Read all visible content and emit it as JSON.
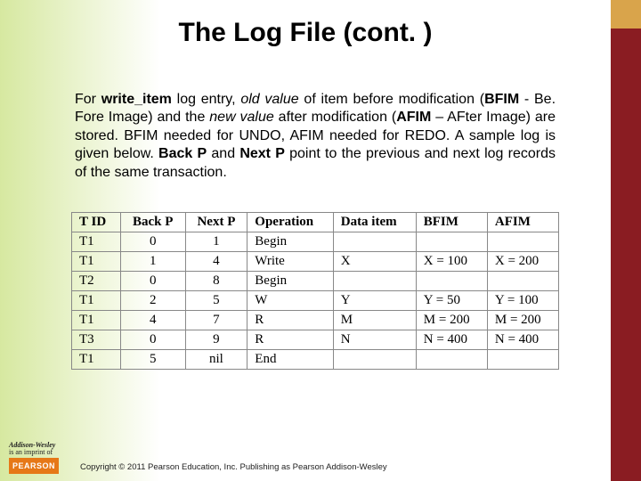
{
  "title": "The Log File (cont. )",
  "paragraph": {
    "p1": "For ",
    "write_item": "write_item",
    "p2": " log entry, ",
    "old_value": "old value",
    "p3": " of item before modification (",
    "bfim_bold": "BFIM",
    "p4": " - Be. Fore Image) and the ",
    "new_value": "new value",
    "p5": " after modification (",
    "afim_bold": "AFIM",
    "p6": " – AFter Image) are stored. BFIM needed for UNDO, AFIM needed for REDO.  A sample log is given below.  ",
    "backp": "Back P",
    "p7": " and ",
    "nextp": "Next P",
    "p8": " point to the previous and next log records of the same transaction."
  },
  "table": {
    "headers": [
      "T ID",
      "Back P",
      "Next P",
      "Operation",
      "Data item",
      "BFIM",
      "AFIM"
    ],
    "rows": [
      [
        "T1",
        "0",
        "1",
        "Begin",
        "",
        "",
        ""
      ],
      [
        "T1",
        "1",
        "4",
        "Write",
        "X",
        "X = 100",
        "X = 200"
      ],
      [
        "T2",
        "0",
        "8",
        "Begin",
        "",
        "",
        ""
      ],
      [
        "T1",
        "2",
        "5",
        "W",
        "Y",
        "Y = 50",
        "Y = 100"
      ],
      [
        "T1",
        "4",
        "7",
        "R",
        "M",
        "M = 200",
        "M = 200"
      ],
      [
        "T3",
        "0",
        "9",
        "R",
        "N",
        "N = 400",
        "N = 400"
      ],
      [
        "T1",
        "5",
        "nil",
        "End",
        "",
        "",
        ""
      ]
    ]
  },
  "footer": "Copyright © 2011 Pearson Education, Inc. Publishing as Pearson Addison-Wesley",
  "badges": {
    "aw1": "Addison-Wesley",
    "aw2": "is an imprint of",
    "pearson": "PEARSON"
  }
}
